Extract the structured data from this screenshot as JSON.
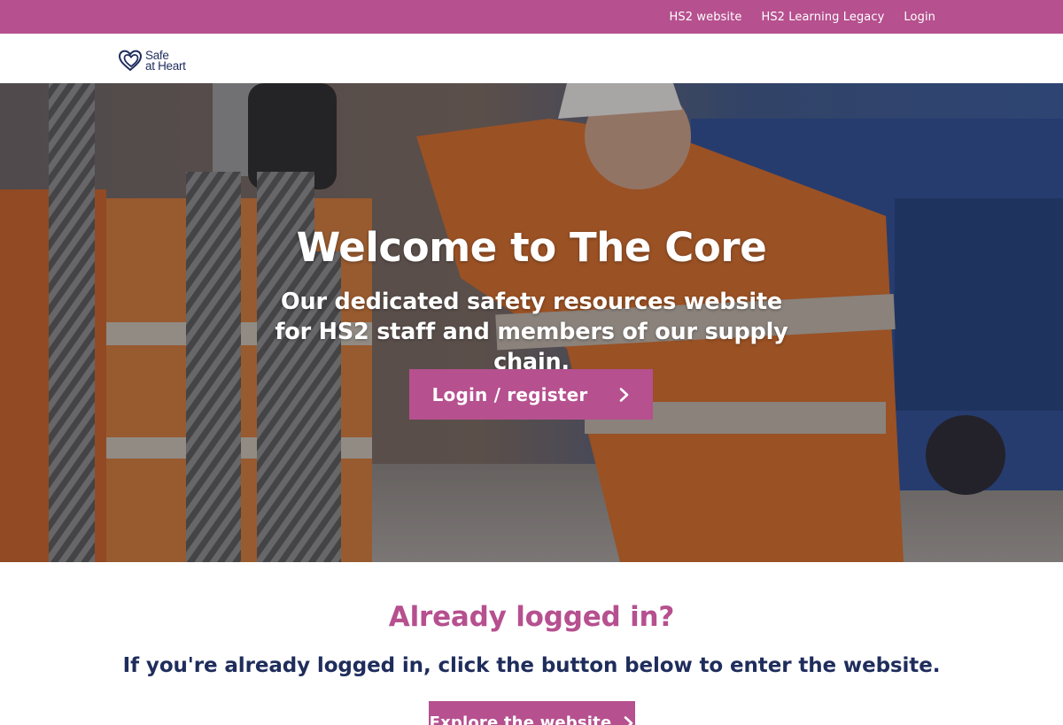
{
  "topbar": {
    "links": [
      {
        "label": "HS2 website"
      },
      {
        "label": "HS2 Learning Legacy"
      },
      {
        "label": "Login"
      }
    ]
  },
  "header": {
    "logo": {
      "line1": "Safe",
      "line2": "at Heart",
      "icon": "double-heart-icon"
    }
  },
  "hero": {
    "title": "Welcome to The Core",
    "subtitle": "Our dedicated safety resources website for HS2 staff and members of our supply chain.",
    "button_label": "Login / register",
    "button_icon": "chevron-right-icon"
  },
  "section": {
    "heading": "Already logged in?",
    "text": "If you're already logged in, click the button below to enter the website.",
    "button_label": "Explore the website",
    "button_icon": "chevron-right-icon"
  },
  "colors": {
    "brand_pink": "#b6508f",
    "navy": "#1f2d5c",
    "white": "#ffffff"
  }
}
